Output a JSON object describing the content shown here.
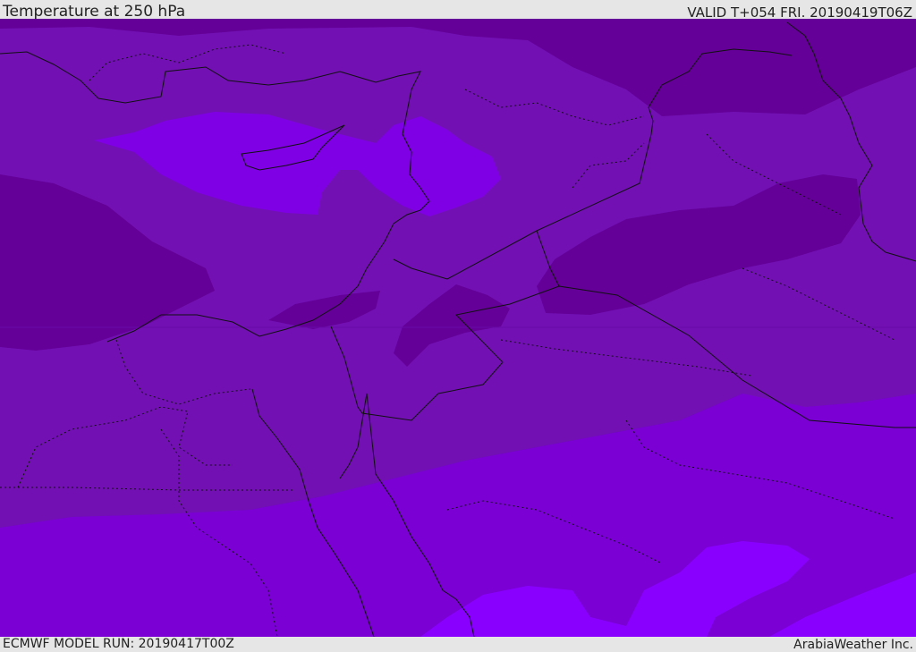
{
  "header": {
    "title": "Temperature at 250 hPa",
    "valid": "VALID T+054 FRI. 20190419T06Z"
  },
  "footer": {
    "model_run": "ECMWF MODEL RUN: 20190417T00Z",
    "credit": "ArabiaWeather Inc."
  },
  "colors": {
    "base": "#7210b4",
    "cold_dark": "#640097",
    "mid_violet": "#7a00d4",
    "warm_violet": "#8000e6",
    "bright_violet": "#8a00ff",
    "coastline": "#111111",
    "background": "#e6e6e6"
  }
}
